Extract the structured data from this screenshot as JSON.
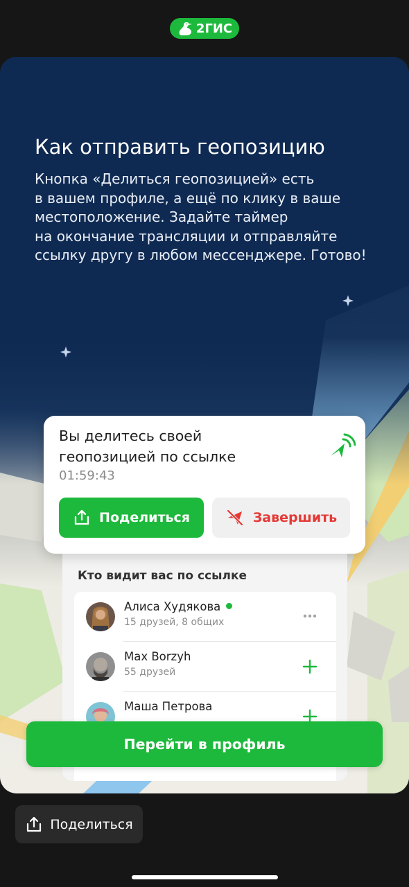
{
  "brand": {
    "logo_text": "2ГИС",
    "accent": "#1db93c"
  },
  "story": {
    "title": "Как отправить геопозицию",
    "description_lines": [
      "Кнопка «Делиться геопозицией» есть",
      "в вашем профиле, а ещё по клику в ваше",
      "местоположение. Задайте таймер",
      "на окончание трансляции и отправляйте",
      "ссылку другу в любом мессенджере. Готово!"
    ]
  },
  "share_card": {
    "title_lines": [
      "Вы делитесь своей",
      "геопозицией по ссылке"
    ],
    "timer": "01:59:43",
    "share_button": "Поделиться",
    "finish_button": "Завершить",
    "finish_color": "#e53935"
  },
  "viewers": {
    "title": "Кто видит вас по ссылке",
    "items": [
      {
        "name": "Алиса Худякова",
        "subtitle": "15 друзей, 8 общих",
        "online": true,
        "action_icon": "more-icon"
      },
      {
        "name": "Max Borzyh",
        "subtitle": "55 друзей",
        "online": false,
        "action_icon": "plus-icon"
      },
      {
        "name": "Маша Петрова",
        "subtitle": "",
        "online": false,
        "action_icon": "plus-icon"
      }
    ]
  },
  "cta": {
    "label": "Перейти в профиль"
  },
  "footer": {
    "share_label": "Поделиться"
  }
}
